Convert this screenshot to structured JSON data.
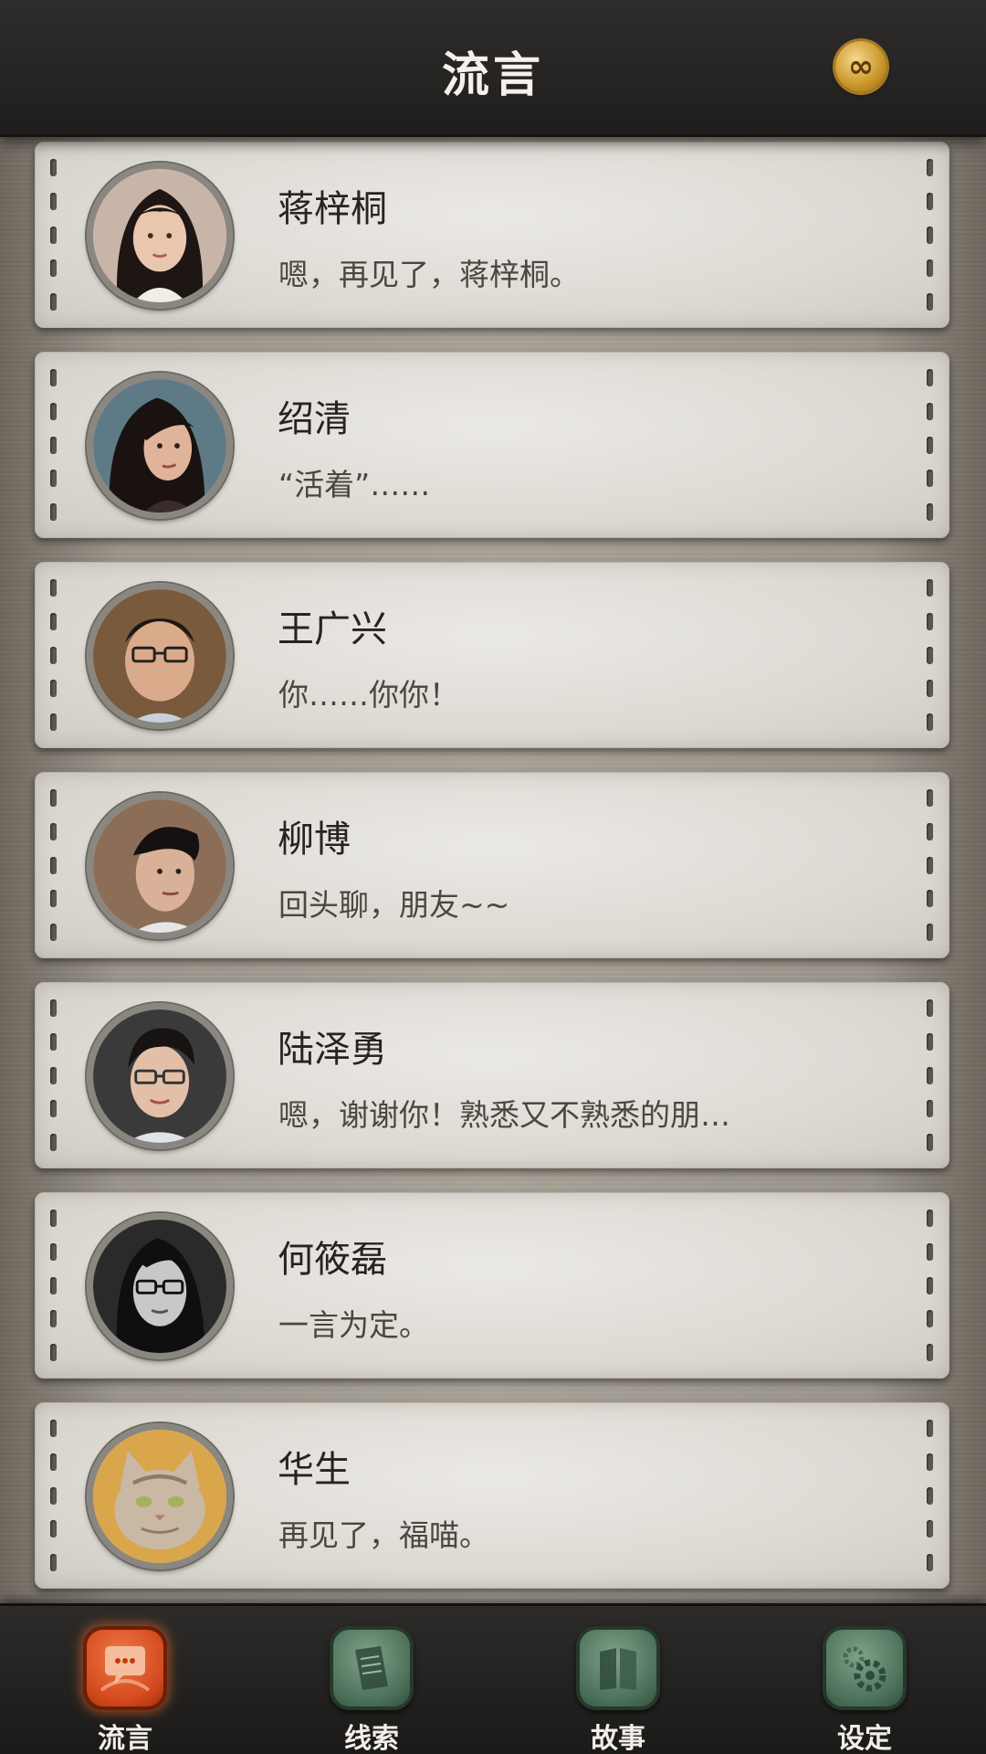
{
  "header": {
    "title": "流言",
    "coin_icon": "infinity-coin-icon",
    "coin_symbol": "∞"
  },
  "contacts": [
    {
      "name": "蒋梓桐",
      "message": "嗯，再见了，蒋梓桐。",
      "avatar": "woman-long-hair-avatar"
    },
    {
      "name": "绍清",
      "message": "“活着”……",
      "avatar": "woman-dark-hair-avatar"
    },
    {
      "name": "王广兴",
      "message": "你……你你！",
      "avatar": "man-glasses-beard-avatar"
    },
    {
      "name": "柳博",
      "message": "回头聊，朋友~~",
      "avatar": "man-slick-hair-avatar"
    },
    {
      "name": "陆泽勇",
      "message": "嗯，谢谢你！熟悉又不熟悉的朋…",
      "avatar": "man-glasses-avatar"
    },
    {
      "name": "何筱磊",
      "message": "一言为定。",
      "avatar": "man-glasses-mono-avatar"
    },
    {
      "name": "华生",
      "message": "再见了，福喵。",
      "avatar": "cat-avatar"
    }
  ],
  "nav": [
    {
      "label": "流言",
      "icon": "chat-bubble-icon",
      "active": true
    },
    {
      "label": "线索",
      "icon": "paper-scroll-icon",
      "active": false
    },
    {
      "label": "故事",
      "icon": "book-icon",
      "active": false
    },
    {
      "label": "设定",
      "icon": "gear-icon",
      "active": false
    }
  ],
  "colors": {
    "active_tab": "#d2481c",
    "inactive_tab": "#4a6e57",
    "bar_bg": "#1f1e1c"
  }
}
